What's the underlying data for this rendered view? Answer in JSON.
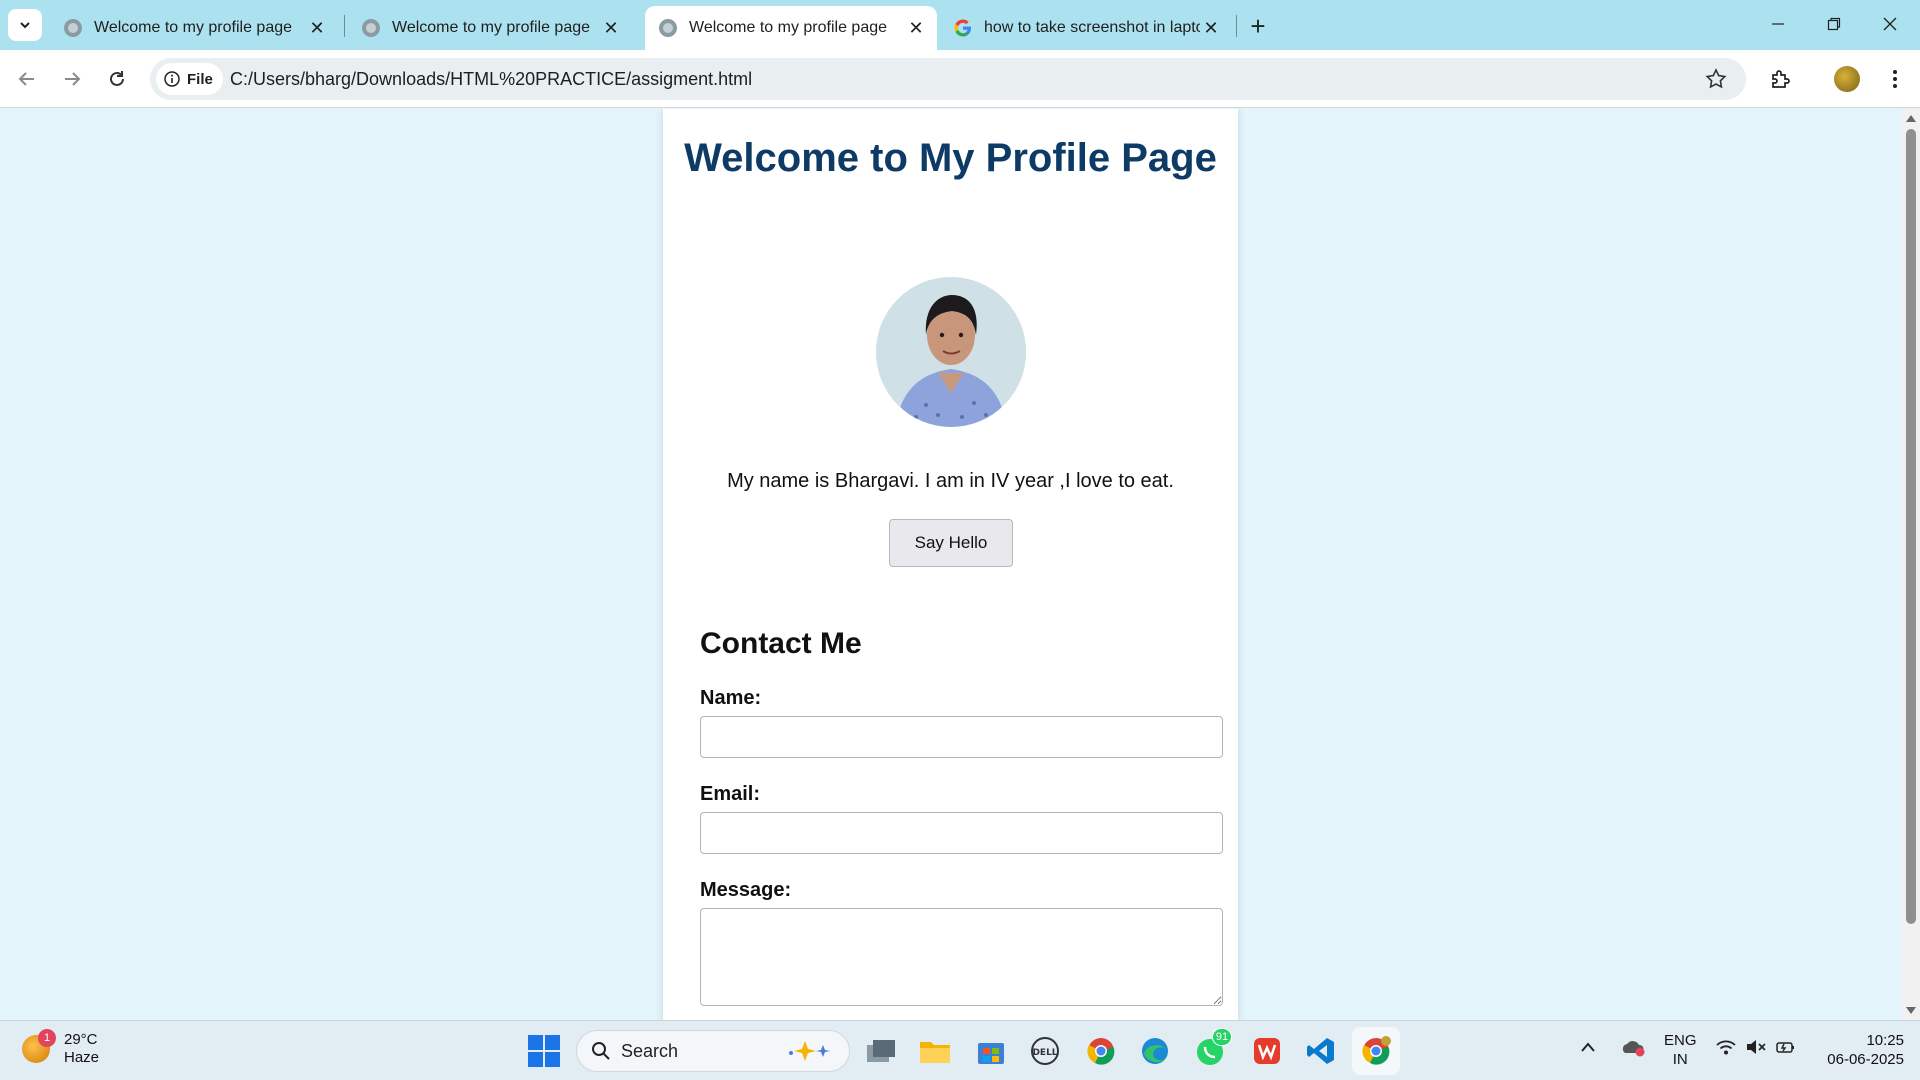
{
  "browser": {
    "tabs": [
      {
        "title": "Welcome to my profile page",
        "active": false,
        "favicon": "globe-icon"
      },
      {
        "title": "Welcome to my profile page",
        "active": false,
        "favicon": "globe-icon"
      },
      {
        "title": "Welcome to my profile page",
        "active": true,
        "favicon": "globe-icon"
      },
      {
        "title": "how to take screenshot in lapto",
        "active": false,
        "favicon": "google-icon"
      }
    ],
    "site_info_label": "File",
    "url": "C:/Users/bharg/Downloads/HTML%20PRACTICE/assigment.html"
  },
  "page": {
    "heading": "Welcome to My Profile Page",
    "intro": "My name is Bhargavi. I am in IV year ,I love to eat.",
    "button_label": "Say Hello",
    "contact_heading": "Contact Me",
    "name_label": "Name:",
    "name_value": "",
    "email_label": "Email:",
    "email_value": "",
    "message_label": "Message:",
    "message_value": ""
  },
  "taskbar": {
    "weather_temp": "29°C",
    "weather_desc": "Haze",
    "weather_badge": "1",
    "search_placeholder": "Search",
    "whatsapp_badge": "91",
    "lang_line1": "ENG",
    "lang_line2": "IN",
    "time": "10:25",
    "date": "06-06-2025"
  }
}
